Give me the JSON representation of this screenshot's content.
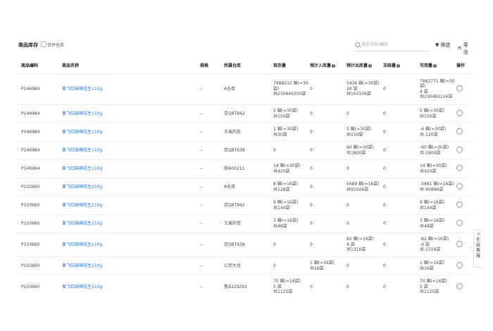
{
  "toolbar": {
    "title": "商品库存",
    "merge_label": "合并仓库",
    "search_placeholder": "商品名称/编码",
    "filter_label": "筛选",
    "export_label": "导出"
  },
  "table": {
    "columns": [
      "商品编码",
      "商品名称",
      "规格",
      "所属仓库",
      "现存量",
      "预计入库量",
      "预计出库量",
      "冻结量",
      "可用量",
      "操作"
    ],
    "rows": [
      {
        "code": "P146984",
        "name": "黄飞红麻辣花生110g",
        "spec": "--",
        "warehouse": "A仓库",
        "stock": [
          "7688210 箱(=30",
          "袋)",
          "共230646300袋"
        ],
        "inbound": [
          "0"
        ],
        "outbound": [
          "5436 箱(=30袋)",
          "26 袋",
          "共163106袋"
        ],
        "frozen": [
          "0"
        ],
        "available": [
          "7682771 箱(=30",
          "袋)",
          "4 袋",
          "共230483134袋"
        ]
      },
      {
        "code": "P146984",
        "name": "黄飞红麻辣花生110g",
        "spec": "--",
        "warehouse": "京Q8T842",
        "stock": [
          "5 箱(=30袋)",
          "共150袋"
        ],
        "inbound": [
          "0"
        ],
        "outbound": [
          "0"
        ],
        "frozen": [
          "0"
        ],
        "available": [
          "5 箱(=30袋)",
          "共150袋"
        ]
      },
      {
        "code": "P146984",
        "name": "黄飞红麻辣花生110g",
        "spec": "--",
        "warehouse": "王禹的车",
        "stock": [
          "1 箱(=30袋)",
          "共30袋"
        ],
        "inbound": [
          "0"
        ],
        "outbound": [
          "5 箱(=30袋)",
          "共150袋"
        ],
        "frozen": [
          "0"
        ],
        "available": [
          "-4 箱(=30袋)",
          "共-120袋"
        ]
      },
      {
        "code": "P146984",
        "name": "黄飞红麻辣花生110g",
        "spec": "--",
        "warehouse": "京Q8T638",
        "stock": [
          "0"
        ],
        "inbound": [
          "0"
        ],
        "outbound": [
          "60 箱(=30袋)",
          "共1800袋"
        ],
        "frozen": [
          "0"
        ],
        "available": [
          "-60 箱(=30袋)",
          "共-1800袋"
        ]
      },
      {
        "code": "P146984",
        "name": "黄飞红麻辣花生110g",
        "spec": "--",
        "warehouse": "皖A00211",
        "stock": [
          "14 箱(=30袋)",
          "共420袋"
        ],
        "inbound": [
          "0"
        ],
        "outbound": [
          "0"
        ],
        "frozen": [
          "0"
        ],
        "available": [
          "14 箱(=30袋)",
          "共420袋"
        ]
      },
      {
        "code": "P103660",
        "name": "黄飞红麻辣花生210g",
        "spec": "--",
        "warehouse": "A仓库",
        "stock": [
          "8 箱(=16袋)",
          "共128袋"
        ],
        "inbound": [
          "0"
        ],
        "outbound": [
          "5689 箱(=16袋)",
          "共91024袋"
        ],
        "frozen": [
          "0"
        ],
        "available": [
          "-5681 箱(=16袋)",
          "共-90896袋"
        ]
      },
      {
        "code": "P103660",
        "name": "黄飞红麻辣花生210g",
        "spec": "--",
        "warehouse": "京Q8T842",
        "stock": [
          "9 箱(=16袋)",
          "共144袋"
        ],
        "inbound": [
          "0"
        ],
        "outbound": [
          "0"
        ],
        "frozen": [
          "0"
        ],
        "available": [
          "9 箱(=16袋)",
          "共144袋"
        ]
      },
      {
        "code": "P103660",
        "name": "黄飞红麻辣花生210g",
        "spec": "--",
        "warehouse": "王禹的车",
        "stock": [
          "3 箱(=16袋)",
          "共48袋"
        ],
        "inbound": [
          "0"
        ],
        "outbound": [
          "0"
        ],
        "frozen": [
          "0"
        ],
        "available": [
          "3 箱(=16袋)",
          "共48袋"
        ]
      },
      {
        "code": "P103660",
        "name": "黄飞红麻辣花生210g",
        "spec": "--",
        "warehouse": "京Q8T638",
        "stock": [
          "0"
        ],
        "inbound": [
          "0"
        ],
        "outbound": [
          "82 箱(=16袋)",
          "4 袋",
          "共1316袋"
        ],
        "frozen": [
          "0"
        ],
        "available": [
          "-82 箱(=16袋)",
          "-4 袋",
          "共-1316袋"
        ]
      },
      {
        "code": "P103660",
        "name": "黄飞红麻辣花生210g",
        "spec": "--",
        "warehouse": "公司大仓",
        "stock": [
          "0"
        ],
        "inbound": [
          "1 箱(=16袋)",
          "共16袋"
        ],
        "outbound": [
          "0"
        ],
        "frozen": [
          "0"
        ],
        "available": [
          "1 箱(=16袋)",
          "共16袋"
        ]
      },
      {
        "code": "P103660",
        "name": "黄飞红麻辣花生210g",
        "spec": "--",
        "warehouse": "鲁A229291",
        "stock": [
          "70 箱(=16袋)",
          "5 袋",
          "共1125袋"
        ],
        "inbound": [
          "0"
        ],
        "outbound": [
          "0"
        ],
        "frozen": [
          "0"
        ],
        "available": [
          "70 箱(=16袋)",
          "5 袋",
          "共1125袋"
        ]
      }
    ]
  },
  "side_service": {
    "label": "在线客服",
    "icon": "headset-icon"
  }
}
